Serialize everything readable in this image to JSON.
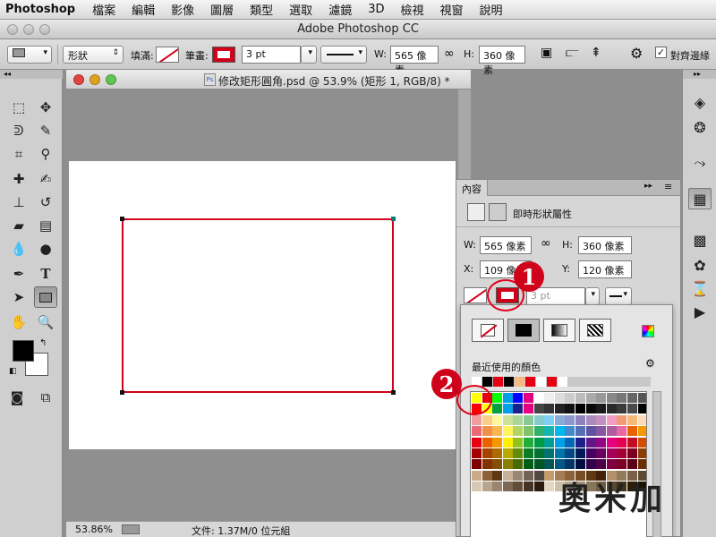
{
  "menubar": {
    "app_name": "Photoshop",
    "items": [
      "檔案",
      "編輯",
      "影像",
      "圖層",
      "類型",
      "選取",
      "濾鏡",
      "3D",
      "檢視",
      "視窗",
      "說明"
    ]
  },
  "window": {
    "title": "Adobe Photoshop CC"
  },
  "options_bar": {
    "mode_select": "形狀",
    "fill_label": "填滿:",
    "stroke_label": "筆畫:",
    "stroke_width": "3 pt",
    "w_label": "W:",
    "w_value": "565 像素",
    "h_label": "H:",
    "h_value": "360 像素",
    "align_edges_label": "對齊邊緣",
    "align_edges_checked": true
  },
  "document": {
    "title": "修改矩形圓角.psd @ 53.9% (矩形 1, RGB/8) *",
    "zoom": "53.86%",
    "file_info": "文件: 1.37M/0 位元組"
  },
  "properties_panel": {
    "tab_label": "內容",
    "header_label": "即時形狀屬性",
    "w_label": "W:",
    "w_value": "565 像素",
    "h_label": "H:",
    "h_value": "360 像素",
    "x_label": "X:",
    "x_value": "109 像素",
    "y_label": "Y:",
    "y_value": "120 像素",
    "stroke_width": "3 pt"
  },
  "swatch_popup": {
    "recent_label": "最近使用的顏色",
    "recent_colors": [
      "#ffffff",
      "#000000",
      "#e60012",
      "#000000",
      "#f7b980",
      "#e60012",
      "#ffffff",
      "#e60012",
      "#ffffff"
    ],
    "swatch_grid": [
      [
        "#ffff00",
        "#e60012",
        "#00ff00",
        "#00a0e9",
        "#0000ff",
        "#e4007f",
        "#ffffff",
        "#eeeeee",
        "#dddddd",
        "#cccccc",
        "#bbbbbb",
        "#aaaaaa",
        "#999999",
        "#888888",
        "#777777",
        "#666666",
        "#555555"
      ],
      [
        "#ff0000",
        "#ffff00",
        "#00a040",
        "#009fe8",
        "#1d2088",
        "#e4007f",
        "#444444",
        "#333333",
        "#222222",
        "#111111",
        "#000000",
        "#0a0a0a",
        "#1a1a1a",
        "#2a2a2a",
        "#3a3a3a",
        "#4a4a4a",
        "#000000"
      ],
      [
        "#f29c9f",
        "#facd89",
        "#fff799",
        "#cce198",
        "#acd598",
        "#89c997",
        "#84ccc9",
        "#7ecef4",
        "#88abda",
        "#8c97cb",
        "#8f82bc",
        "#aa89bd",
        "#c490bf",
        "#f19ec2",
        "#f29b76",
        "#f5b977",
        "#fcd9b8"
      ],
      [
        "#eb6877",
        "#f19149",
        "#f8b551",
        "#fff45c",
        "#b3d465",
        "#80c269",
        "#32b16c",
        "#13b5b1",
        "#00b7ee",
        "#448aca",
        "#556fb5",
        "#5f52a0",
        "#8957a1",
        "#ae5da1",
        "#ea68a2",
        "#eb6100",
        "#f39800"
      ],
      [
        "#e60012",
        "#eb6100",
        "#f39800",
        "#fff100",
        "#8fc31f",
        "#22ac38",
        "#009944",
        "#009e96",
        "#00a0e9",
        "#0068b7",
        "#1d2088",
        "#601986",
        "#920783",
        "#e4007f",
        "#e5004f",
        "#c30d23",
        "#d54b00"
      ],
      [
        "#a40000",
        "#a84200",
        "#ac6a00",
        "#b7aa00",
        "#638c0b",
        "#097c25",
        "#007130",
        "#00736d",
        "#0075a9",
        "#004986",
        "#001c58",
        "#440062",
        "#6a005f",
        "#a4005b",
        "#a40035",
        "#7d0022",
        "#8c3d00"
      ],
      [
        "#7d0000",
        "#813200",
        "#834f00",
        "#8a8000",
        "#486a00",
        "#005e15",
        "#005524",
        "#005652",
        "#005982",
        "#003567",
        "#000d3f",
        "#32004a",
        "#4f0047",
        "#7e0043",
        "#7d0026",
        "#5c0017",
        "#6b2e00"
      ],
      [
        "#c9ab8a",
        "#8c6239",
        "#603813",
        "#c7b299",
        "#998675",
        "#736357",
        "#534741",
        "#c69c6d",
        "#a67c52",
        "#8c6239",
        "#754c24",
        "#603813",
        "#42210b",
        "#b39069",
        "#927a5a",
        "#7a6044",
        "#5f4a31"
      ],
      [
        "#d7c9b4",
        "#b8a68f",
        "#9a8670",
        "#7d6853",
        "#604c39",
        "#453222",
        "#2c1c10",
        "#e2d7c3",
        "#cbbfa7",
        "#b4a68b",
        "#9d8e72",
        "#867659",
        "#6f5f42",
        "#58482c",
        "#413218",
        "#2b1f08",
        "#1a1203"
      ]
    ]
  },
  "callouts": {
    "one": "1",
    "two": "2"
  },
  "watermark": {
    "text": "奧米加"
  }
}
